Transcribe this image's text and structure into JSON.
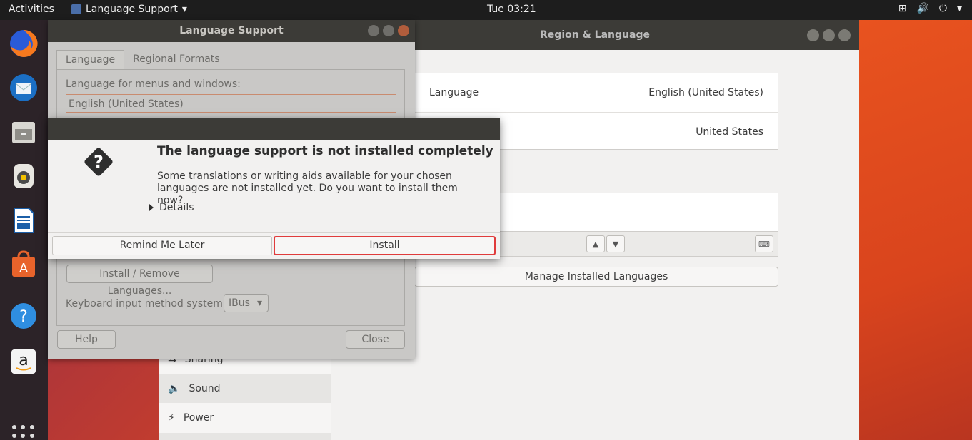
{
  "topbar": {
    "activities": "Activities",
    "app_menu": "Language Support",
    "clock": "Tue 03:21"
  },
  "settings": {
    "title": "Region & Language",
    "sidebar": [
      {
        "label": "Sharing"
      },
      {
        "label": "Sound"
      },
      {
        "label": "Power"
      }
    ],
    "language_label": "Language",
    "language_value": "English (United States)",
    "formats_value": "United States",
    "manage_button": "Manage Installed Languages"
  },
  "language_support": {
    "title": "Language Support",
    "tab_language": "Language",
    "tab_regional": "Regional Formats",
    "menus_label": "Language for menus and windows:",
    "list_item": "English (United States)",
    "install_remove": "Install / Remove Languages...",
    "kb_label": "Keyboard input method system:",
    "kb_value": "IBus",
    "help": "Help",
    "close": "Close"
  },
  "dialog": {
    "heading": "The language support is not installed completely",
    "body": "Some translations or writing aids available for your chosen languages are not installed yet. Do you want to install them now?",
    "details": "Details",
    "remind_button": "Remind Me Later",
    "install_button": "Install"
  },
  "colors": {
    "highlight": "#e03b3b",
    "titlebar": "#3c3b37"
  }
}
